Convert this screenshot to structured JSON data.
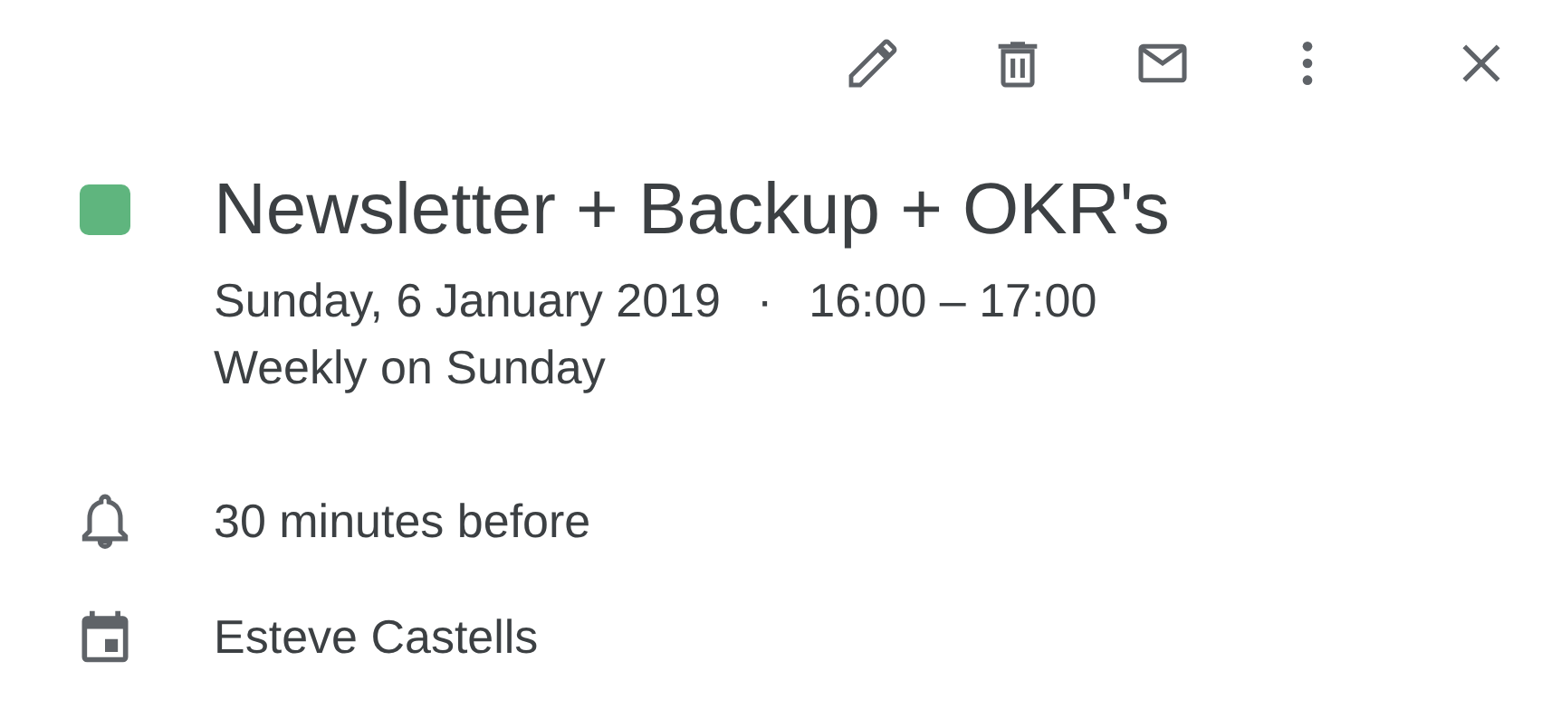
{
  "toolbar": [
    {
      "kind": "edit"
    },
    {
      "kind": "delete"
    },
    {
      "kind": "email"
    },
    {
      "kind": "more"
    },
    {
      "kind": "close"
    }
  ],
  "event": {
    "title": "Newsletter + Backup + OKR's",
    "color": "#5fb57e",
    "date": "Sunday, 6 January 2019",
    "separator": "·",
    "time": "16:00 – 17:00",
    "recurrence": "Weekly on Sunday"
  },
  "details": [
    {
      "kind": "reminder",
      "text": "30 minutes before"
    },
    {
      "kind": "calendar",
      "text": "Esteve Castells"
    }
  ]
}
